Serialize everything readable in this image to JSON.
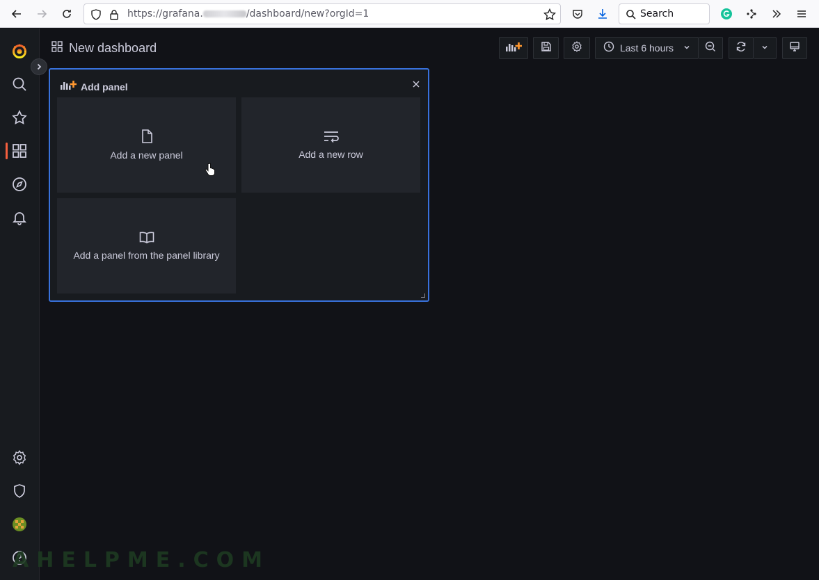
{
  "browser": {
    "url_prefix": "https://grafana.",
    "url_suffix": "/dashboard/new?orgId=1",
    "search_placeholder": "Search"
  },
  "dashboard": {
    "title": "New dashboard",
    "time_range": "Last 6 hours"
  },
  "add_panel": {
    "title": "Add panel",
    "options": [
      {
        "label": "Add a new panel",
        "icon": "file-icon"
      },
      {
        "label": "Add a new row",
        "icon": "row-icon"
      },
      {
        "label": "Add a panel from the panel library",
        "icon": "book-icon"
      }
    ]
  },
  "sidebar": {
    "items": [
      "grafana-logo",
      "search-icon",
      "star-icon",
      "dashboards-icon",
      "explore-icon",
      "alerting-icon",
      "settings-icon",
      "shield-icon",
      "avatar",
      "help-icon"
    ],
    "active_item": "dashboards-icon"
  },
  "colors": {
    "accent": "#3871dc",
    "brand": "#f55f3e",
    "background": "#111217",
    "panel": "#181b1f"
  },
  "watermark": "AHELPME.COM"
}
